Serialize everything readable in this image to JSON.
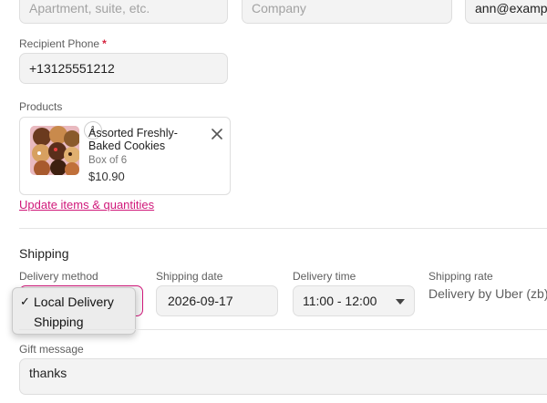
{
  "address": {
    "apartment_placeholder": "Apartment, suite, etc.",
    "company_placeholder": "Company",
    "email_value": "ann@exampl"
  },
  "phone": {
    "label": "Recipient Phone",
    "required_mark": "*",
    "value": "+13125551212"
  },
  "products": {
    "label": "Products",
    "items": [
      {
        "quantity": "1",
        "name": "Assorted Freshly-Baked Cookies",
        "variant": "Box of 6",
        "price": "$10.90",
        "remove_icon": "close-icon"
      }
    ],
    "update_link": "Update items & quantities"
  },
  "shipping": {
    "title": "Shipping",
    "method_label": "Delivery method",
    "method_options": [
      {
        "label": "Local Delivery",
        "selected": true,
        "check_glyph": "✓"
      },
      {
        "label": "Shipping",
        "selected": false
      }
    ],
    "date_label": "Shipping date",
    "date_value": "2026-09-17",
    "time_label": "Delivery time",
    "time_value": "11:00 - 12:00",
    "rate_label": "Shipping rate",
    "rate_value": "Delivery by Uber (zb)"
  },
  "gift": {
    "label": "Gift message",
    "value": "thanks"
  },
  "colors": {
    "accent": "#d0187a",
    "required": "#d5243f"
  }
}
